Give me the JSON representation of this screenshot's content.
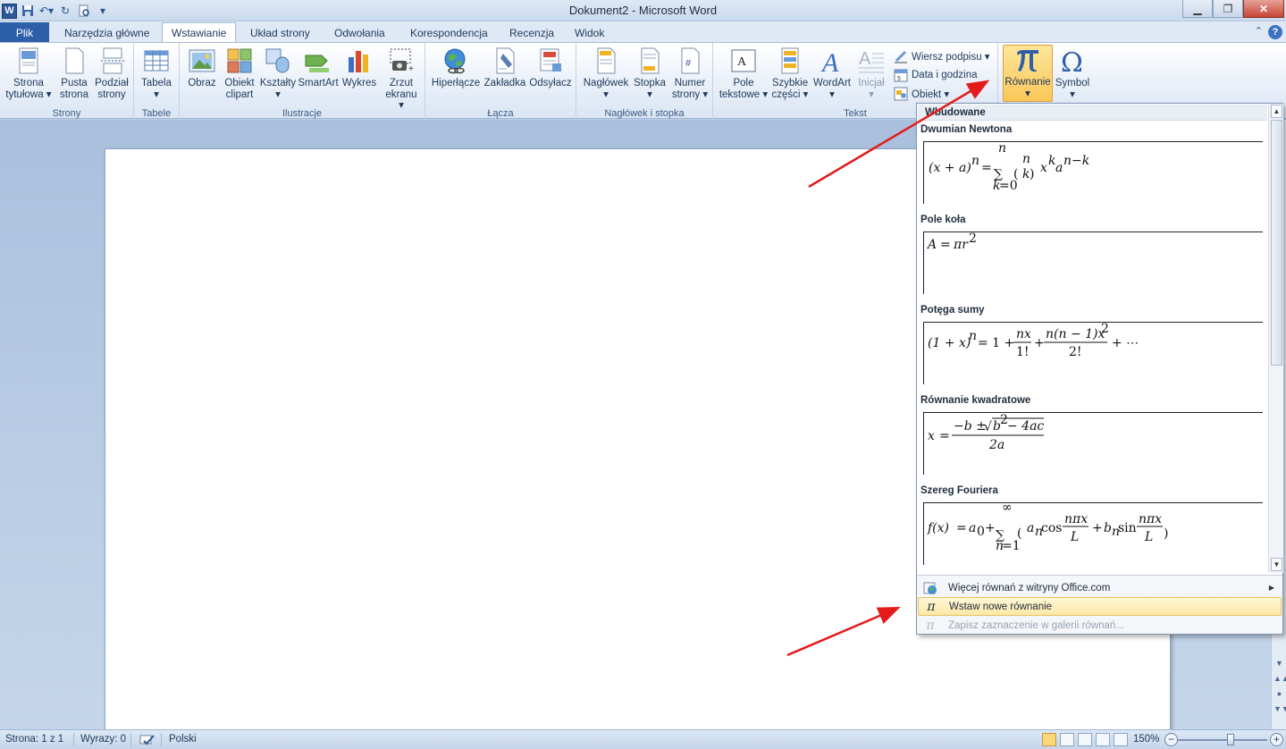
{
  "window": {
    "title": "Dokument2 - Microsoft Word",
    "app_logo": "W",
    "buttons": [
      "minimize-icon",
      "restore-icon",
      "close-icon"
    ]
  },
  "tabs": [
    "Plik",
    "Narzędzia główne",
    "Wstawianie",
    "Układ strony",
    "Odwołania",
    "Korespondencja",
    "Recenzja",
    "Widok"
  ],
  "active_tab": "Wstawianie",
  "ribbon": {
    "groups": {
      "strony": "Strony",
      "tabele": "Tabele",
      "ilustracje": "Ilustracje",
      "lacza": "Łącza",
      "naglowek": "Nagłówek i stopka",
      "tekst": "Tekst"
    },
    "buttons": {
      "strona_tytulowa": [
        "Strona",
        "tytułowa ▾"
      ],
      "pusta_strona": [
        "Pusta",
        "strona"
      ],
      "podzial_strony": [
        "Podział",
        "strony"
      ],
      "tabela": [
        "Tabela",
        "▾"
      ],
      "obraz": [
        "Obraz"
      ],
      "obiekt_clipart": [
        "Obiekt",
        "clipart"
      ],
      "ksztalty": [
        "Kształty",
        "▾"
      ],
      "smartart": [
        "SmartArt"
      ],
      "wykres": [
        "Wykres"
      ],
      "zrzut_ekranu": [
        "Zrzut",
        "ekranu ▾"
      ],
      "hiperlacze": [
        "Hiperłącze"
      ],
      "zakladka": [
        "Zakładka"
      ],
      "odsylacz": [
        "Odsyłacz"
      ],
      "naglowek": [
        "Nagłówek",
        "▾"
      ],
      "stopka": [
        "Stopka",
        "▾"
      ],
      "numer_strony": [
        "Numer",
        "strony ▾"
      ],
      "pole_tekstowe": [
        "Pole",
        "tekstowe ▾"
      ],
      "szybkie_czesci": [
        "Szybkie",
        "części ▾"
      ],
      "wordart": [
        "WordArt",
        "▾"
      ],
      "inicjal": [
        "Inicjał",
        "▾"
      ],
      "rownanie": [
        "Równanie",
        "▾"
      ],
      "symbol": [
        "Symbol",
        "▾"
      ]
    },
    "small_buttons": {
      "wiersz_podpisu": "Wiersz podpisu ▾",
      "data_godzina": "Data i godzina",
      "obiekt": "Obiekt ▾"
    }
  },
  "equation_gallery": {
    "header": "Wbudowane",
    "items": [
      {
        "title": "Dwumian Newtona"
      },
      {
        "title": "Pole koła"
      },
      {
        "title": "Potęga sumy"
      },
      {
        "title": "Równanie kwadratowe"
      },
      {
        "title": "Szereg Fouriera"
      }
    ],
    "menu": [
      {
        "label": "Więcej równań z witryny Office.com",
        "icon": "office-com-icon",
        "state": "normal",
        "has_submenu": true
      },
      {
        "label": "Wstaw nowe równanie",
        "icon": "pi-icon",
        "state": "hover",
        "has_submenu": false
      },
      {
        "label": "Zapisz zaznaczenie w galerii równań...",
        "icon": "pi-save-icon",
        "state": "disabled",
        "has_submenu": false
      }
    ]
  },
  "status_bar": {
    "page": "Strona: 1 z 1",
    "words": "Wyrazy: 0",
    "language": "Polski",
    "zoom": "150%"
  },
  "colors": {
    "annotation_arrow": "#e31b1b",
    "file_tab": "#2c5fa8",
    "pressed_button": "#fbc75a"
  }
}
